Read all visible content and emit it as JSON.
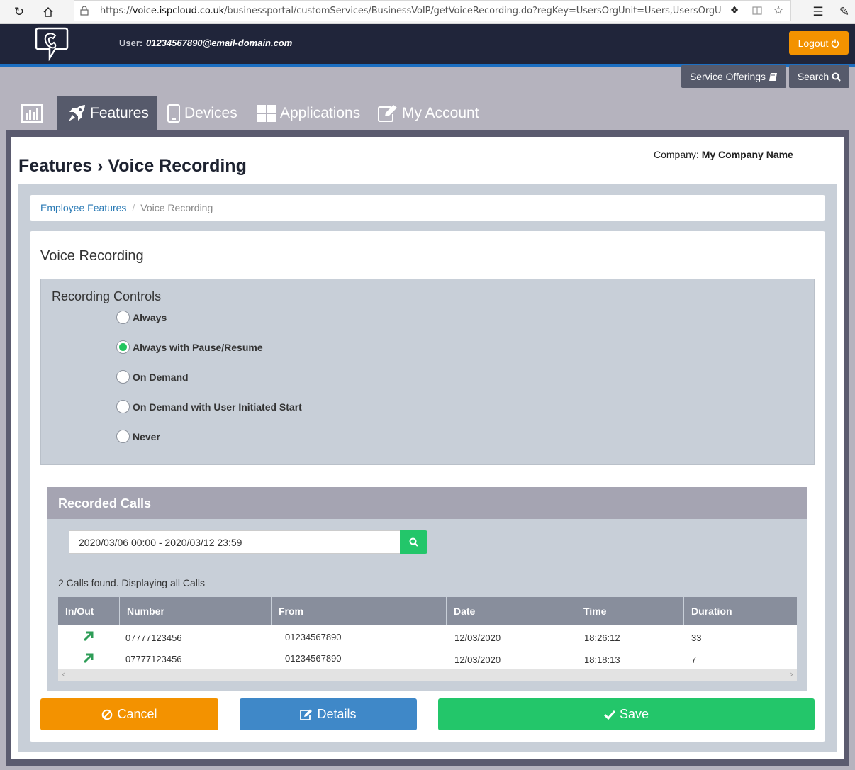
{
  "browser": {
    "url_scheme": "https://",
    "url_host": "voice.ispcloud.co.uk",
    "url_path": "/businessportal/customServices/BusinessVoIP/getVoiceRecording.do?regKey=UsersOrgUnit=Users,UsersOrgUnit=Customers,U"
  },
  "header": {
    "user_label": "User:",
    "user_email": "01234567890@email-domain.com",
    "logout_label": "Logout",
    "service_offerings_label": "Service Offerings",
    "search_label": "Search"
  },
  "tabs": [
    {
      "label": ""
    },
    {
      "label": "Features"
    },
    {
      "label": "Devices"
    },
    {
      "label": "Applications"
    },
    {
      "label": "My Account"
    }
  ],
  "page": {
    "title": "Features › Voice Recording",
    "company_label": "Company:",
    "company_name": "My Company Name"
  },
  "breadcrumb": {
    "link": "Employee Features",
    "separator": "/",
    "current": "Voice Recording"
  },
  "card_title": "Voice Recording",
  "recording_controls": {
    "title": "Recording Controls",
    "options": [
      {
        "label": "Always",
        "checked": false
      },
      {
        "label": "Always with Pause/Resume",
        "checked": true
      },
      {
        "label": "On Demand",
        "checked": false
      },
      {
        "label": "On Demand with User Initiated Start",
        "checked": false
      },
      {
        "label": "Never",
        "checked": false
      }
    ]
  },
  "recorded_calls": {
    "title": "Recorded Calls",
    "date_range": "2020/03/06 00:00 - 2020/03/12 23:59",
    "summary": "2 Calls found. Displaying all Calls",
    "columns": [
      "In/Out",
      "Number",
      "From",
      "Date",
      "Time",
      "Duration"
    ],
    "rows": [
      {
        "direction": "outgoing-arrow-icon",
        "number": "07777123456",
        "from": "01234567890",
        "date": "12/03/2020",
        "time": "18:26:12",
        "duration": "33"
      },
      {
        "direction": "outgoing-arrow-icon",
        "number": "07777123456",
        "from": "01234567890",
        "date": "12/03/2020",
        "time": "18:18:13",
        "duration": "7"
      }
    ]
  },
  "actions": {
    "cancel_label": "Cancel",
    "details_label": "Details",
    "save_label": "Save"
  },
  "colors": {
    "header_bg": "#20253a",
    "accent_orange": "#f39200",
    "accent_blue": "#3f88c8",
    "accent_green": "#23c66a",
    "tab_active": "#565a6b"
  }
}
